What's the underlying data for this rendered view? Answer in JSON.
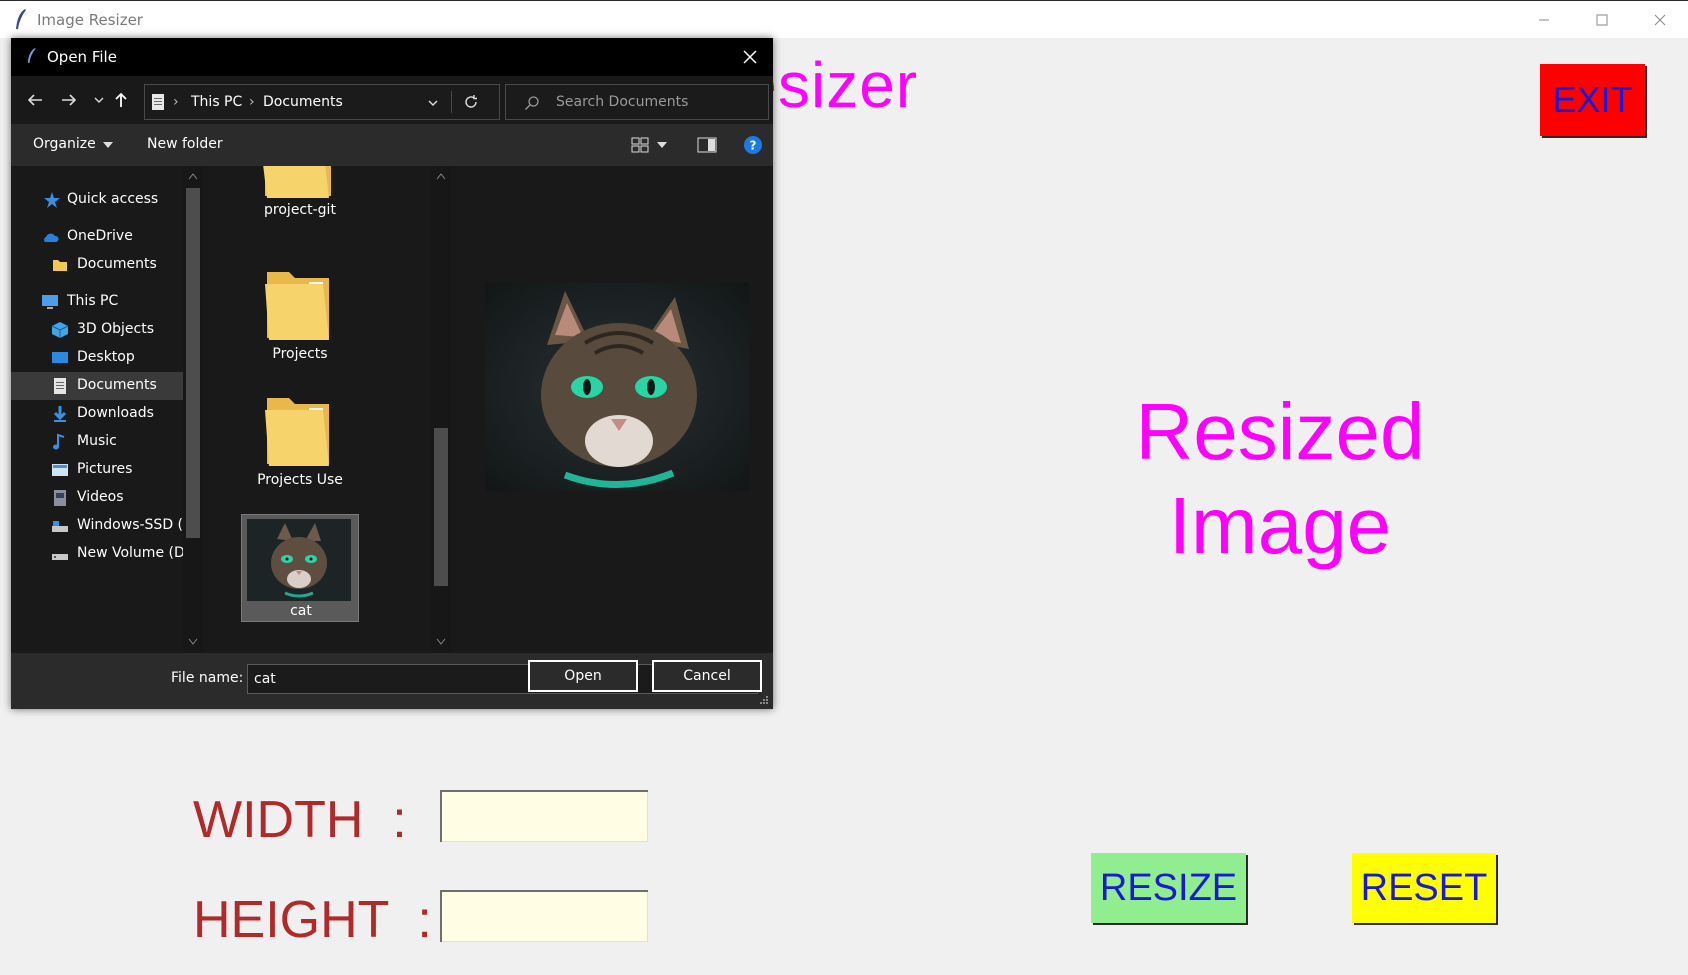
{
  "window": {
    "title": "Image Resizer"
  },
  "app": {
    "title_partial": "e  Resizer",
    "exit_label": "EXIT",
    "resized_placeholder_line1": "Resized",
    "resized_placeholder_line2": "Image",
    "width_label": "WIDTH  :",
    "height_label": "HEIGHT  :",
    "width_value": "",
    "height_value": "",
    "resize_label": "RESIZE",
    "reset_label": "RESET"
  },
  "dialog": {
    "title": "Open File",
    "address": {
      "crumbs": [
        "This PC",
        "Documents"
      ]
    },
    "search_placeholder": "Search Documents",
    "commands": {
      "organize": "Organize",
      "new_folder": "New folder"
    },
    "nav_items": [
      {
        "label": "Quick access",
        "icon": "star-icon"
      },
      {
        "label": "OneDrive",
        "icon": "cloud-icon"
      },
      {
        "label": "Documents",
        "icon": "folder-icon"
      },
      {
        "label": "This PC",
        "icon": "computer-icon"
      },
      {
        "label": "3D Objects",
        "icon": "cube-icon"
      },
      {
        "label": "Desktop",
        "icon": "desktop-icon"
      },
      {
        "label": "Documents",
        "icon": "document-icon",
        "selected": true
      },
      {
        "label": "Downloads",
        "icon": "download-arrow-icon"
      },
      {
        "label": "Music",
        "icon": "music-note-icon"
      },
      {
        "label": "Pictures",
        "icon": "pictures-icon"
      },
      {
        "label": "Videos",
        "icon": "video-icon"
      },
      {
        "label": "Windows-SSD (C",
        "icon": "drive-icon"
      },
      {
        "label": "New Volume (D:",
        "icon": "drive-icon"
      }
    ],
    "files": [
      {
        "name": "project-git",
        "type": "folder"
      },
      {
        "name": "Projects",
        "type": "folder"
      },
      {
        "name": "Projects Use",
        "type": "folder"
      },
      {
        "name": "cat",
        "type": "image",
        "selected": true
      }
    ],
    "file_name_label": "File name:",
    "file_name_value": "cat",
    "open_label": "Open",
    "cancel_label": "Cancel"
  },
  "colors": {
    "accent_magenta": "#ff00ff",
    "exit_bg": "#ff0000",
    "resize_bg": "#90ee90",
    "reset_bg": "#ffff00",
    "button_text": "#1a1ad6",
    "label_red": "#b02a2a",
    "input_bg": "#fffde4"
  }
}
